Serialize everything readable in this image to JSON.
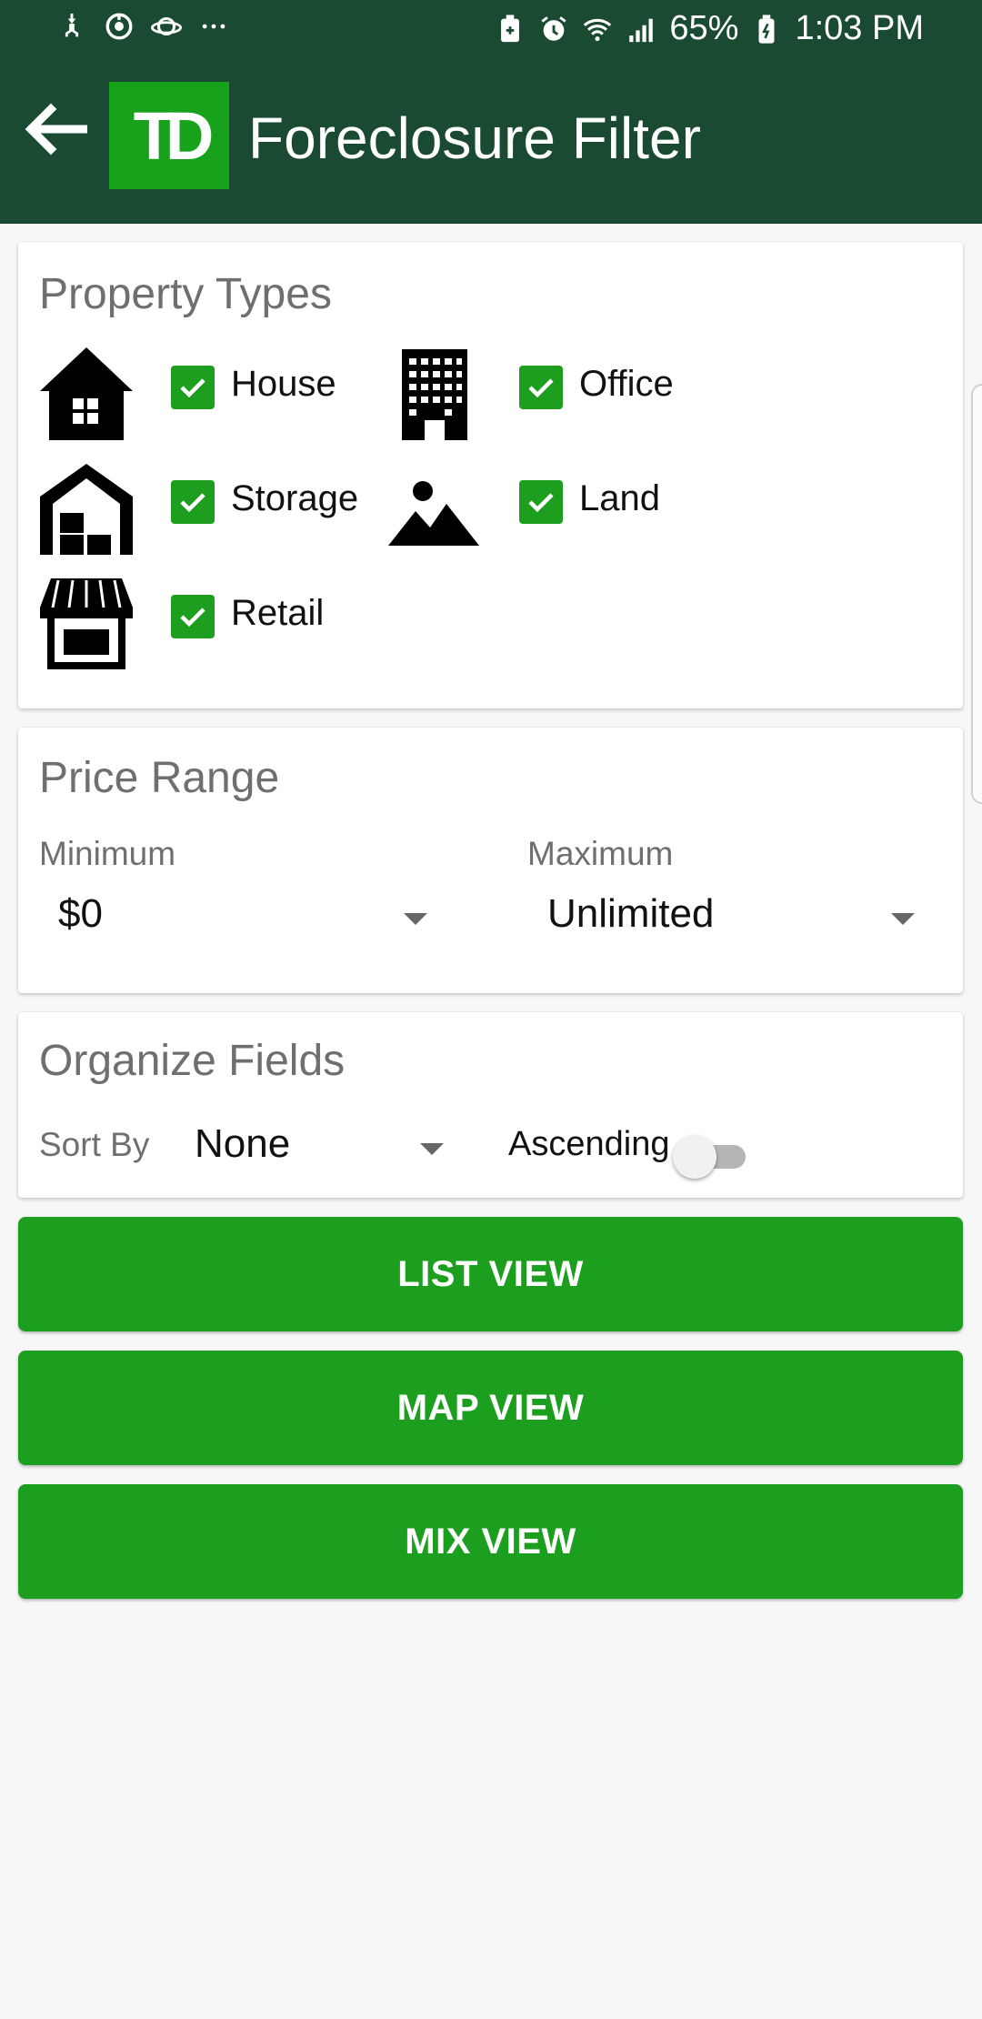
{
  "status_bar": {
    "battery": "65%",
    "time": "1:03 PM",
    "icons_left": [
      "usb-icon",
      "sync-icon",
      "planet-icon",
      "more-dots-icon"
    ],
    "icons_right": [
      "battery-saver-icon",
      "alarm-icon",
      "wifi-icon",
      "signal-icon",
      "battery-icon"
    ]
  },
  "app_bar": {
    "logo": "TD",
    "title": "Foreclosure Filter"
  },
  "property_types": {
    "title": "Property Types",
    "items": [
      {
        "label": "House",
        "checked": true,
        "icon": "house-icon"
      },
      {
        "label": "Office",
        "checked": true,
        "icon": "office-building-icon"
      },
      {
        "label": "Storage",
        "checked": true,
        "icon": "storage-icon"
      },
      {
        "label": "Land",
        "checked": true,
        "icon": "land-icon"
      },
      {
        "label": "Retail",
        "checked": true,
        "icon": "retail-store-icon"
      }
    ]
  },
  "price_range": {
    "title": "Price Range",
    "minimum_label": "Minimum",
    "minimum_value": "$0",
    "maximum_label": "Maximum",
    "maximum_value": "Unlimited"
  },
  "organize_fields": {
    "title": "Organize Fields",
    "sort_by_label": "Sort By",
    "sort_by_value": "None",
    "ascending_label": "Ascending",
    "ascending_on": false
  },
  "buttons": {
    "list_view": "LIST VIEW",
    "map_view": "MAP VIEW",
    "mix_view": "MIX VIEW"
  },
  "colors": {
    "header": "#1a4a31",
    "accent": "#1c9e1e",
    "logo": "#18a21c"
  }
}
